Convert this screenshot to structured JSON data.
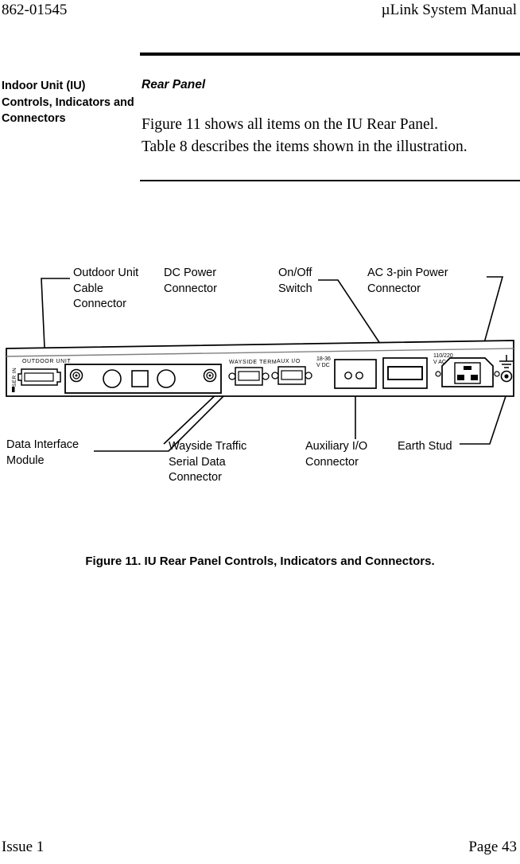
{
  "running_head": {
    "document_number": "862-01545",
    "manual_title": "µLink System Manual"
  },
  "marginal_head": "Indoor Unit (IU) Controls, Indicators and Connectors",
  "section": {
    "subhead": "Rear Panel",
    "body_line_1": "Figure 11 shows all items on the IU Rear Panel.",
    "body_line_2": "Table 8 describes the items shown in the illustration."
  },
  "figure": {
    "caption": "Figure 11.  IU Rear Panel Controls, Indicators and Connectors.",
    "callouts": {
      "outdoor_unit_cable_connector": "Outdoor Unit\nCable\nConnector",
      "dc_power_connector": "DC Power\nConnector",
      "on_off_switch": "On/Off\nSwitch",
      "ac_power_connector": "AC 3-pin Power\nConnector",
      "data_interface_module": "Data Interface\nModule",
      "wayside_serial_connector": "Wayside Traffic\nSerial Data\nConnector",
      "auxiliary_io_connector": "Auxiliary I/O\nConnector",
      "earth_stud": "Earth Stud"
    },
    "panel_silkscreen": {
      "ser_in": "SER IN",
      "outdoor_unit": "OUTDOOR UNIT",
      "wayside_term": "WAYSIDE TERM",
      "aux_io": "AUX I/O",
      "dc_rating_line1": "18-36",
      "dc_rating_line2": "V DC",
      "ac_rating_line1": "110/220",
      "ac_rating_line2": "V AC"
    }
  },
  "footer": {
    "issue": "Issue 1",
    "page": "Page 43"
  },
  "colors": {
    "ink": "#000000",
    "paper": "#ffffff",
    "panel_shade": "#808080"
  }
}
